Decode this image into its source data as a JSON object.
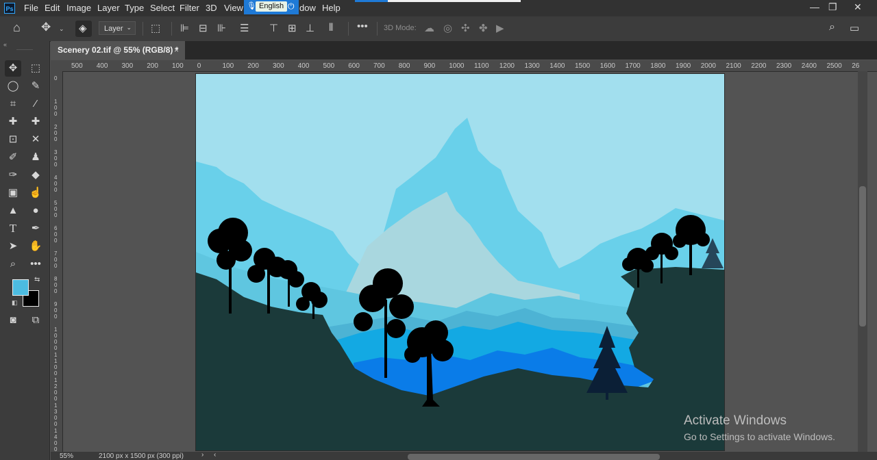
{
  "menu": {
    "logo": "Ps",
    "items": [
      "File",
      "Edit",
      "Image",
      "Layer",
      "Type",
      "Select",
      "Filter",
      "3D",
      "View",
      "dow",
      "Help"
    ]
  },
  "language_bar": {
    "label": "English"
  },
  "options_bar": {
    "layer_dropdown": "Layer",
    "mode_3d_label": "3D Mode:"
  },
  "document_tab": {
    "title": "Scenery 02.tif @ 55% (RGB/8) *",
    "close": "×"
  },
  "ruler": {
    "h_ticks": [
      "500",
      "400",
      "300",
      "200",
      "100",
      "0",
      "100",
      "200",
      "300",
      "400",
      "500",
      "600",
      "700",
      "800",
      "900",
      "1000",
      "1100",
      "1200",
      "1300",
      "1400",
      "1500",
      "1600",
      "1700",
      "1800",
      "1900",
      "2000",
      "2100",
      "2200",
      "2300",
      "2400",
      "2500",
      "26"
    ]
  },
  "colors": {
    "foreground": "#4cbbe0",
    "background": "#000000",
    "app_bg": "#535353",
    "panel_bg": "#3c3c3c"
  },
  "status_bar": {
    "zoom": "55%",
    "doc_info": "2100 px x 1500 px (300 ppi)"
  },
  "watermark": {
    "title": "Activate Windows",
    "subtitle": "Go to Settings to activate Windows."
  }
}
